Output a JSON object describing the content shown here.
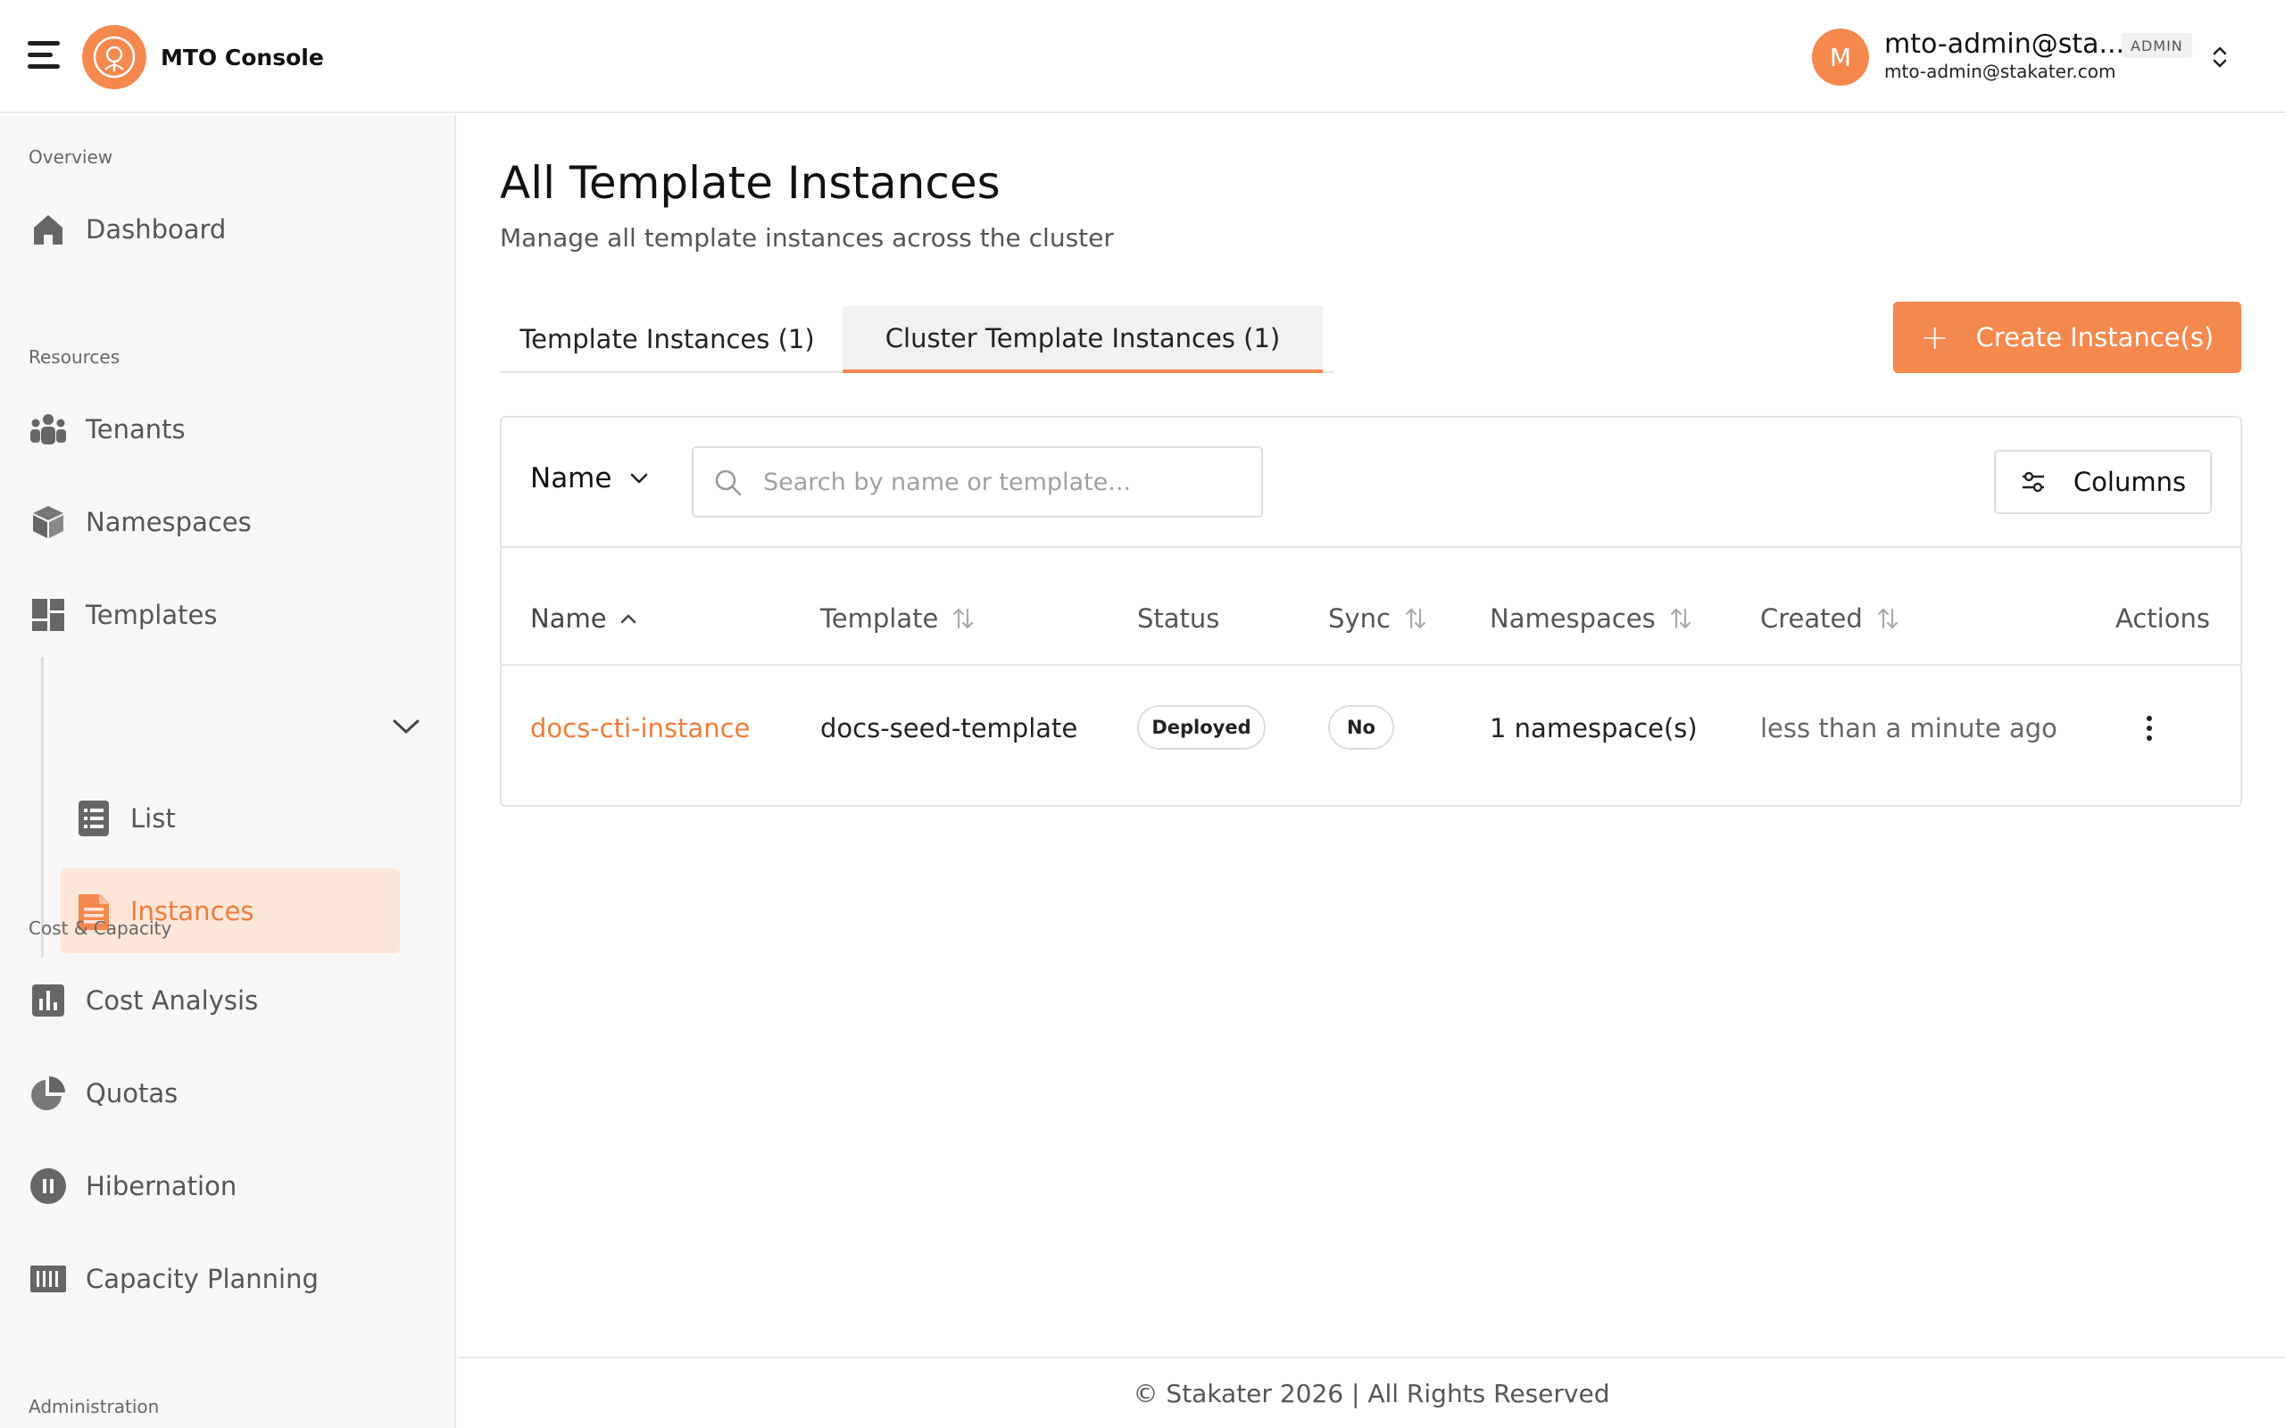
{
  "app": {
    "title": "MTO Console"
  },
  "user": {
    "avatar_letter": "M",
    "name": "mto-admin@sta...",
    "email": "mto-admin@stakater.com",
    "role": "ADMIN"
  },
  "sidebar": {
    "sections": {
      "overview": "Overview",
      "resources": "Resources",
      "cost": "Cost & Capacity",
      "admin": "Administration"
    },
    "items": {
      "dashboard": "Dashboard",
      "tenants": "Tenants",
      "namespaces": "Namespaces",
      "templates": "Templates",
      "templates_list": "List",
      "templates_instances": "Instances",
      "cost_analysis": "Cost Analysis",
      "quotas": "Quotas",
      "hibernation": "Hibernation",
      "capacity_planning": "Capacity Planning"
    },
    "active_item": "Instances"
  },
  "main": {
    "title": "All Template Instances",
    "subtitle": "Manage all template instances across the cluster",
    "tabs": [
      {
        "label": "Template Instances (1)",
        "active": false
      },
      {
        "label": "Cluster Template Instances (1)",
        "active": true
      }
    ],
    "create_button": "Create Instance(s)",
    "filter": {
      "field": "Name",
      "search_placeholder": "Search by name or template...",
      "search_value": "",
      "columns_button": "Columns"
    },
    "table": {
      "headers": [
        "Name",
        "Template",
        "Status",
        "Sync",
        "Namespaces",
        "Created",
        "Actions"
      ],
      "sorted_by": "Name",
      "sort_direction": "ascending",
      "rows": [
        {
          "name": "docs-cti-instance",
          "template": "docs-seed-template",
          "status": "Deployed",
          "sync": "No",
          "namespaces": "1 namespace(s)",
          "created": "less than a minute ago"
        }
      ]
    }
  },
  "footer": {
    "text": "© Stakater 2026 | All Rights Reserved"
  },
  "colors": {
    "accent": "#f5884d",
    "active_bg": "#fde5d8",
    "sidebar_bg": "#f7f7f7"
  }
}
